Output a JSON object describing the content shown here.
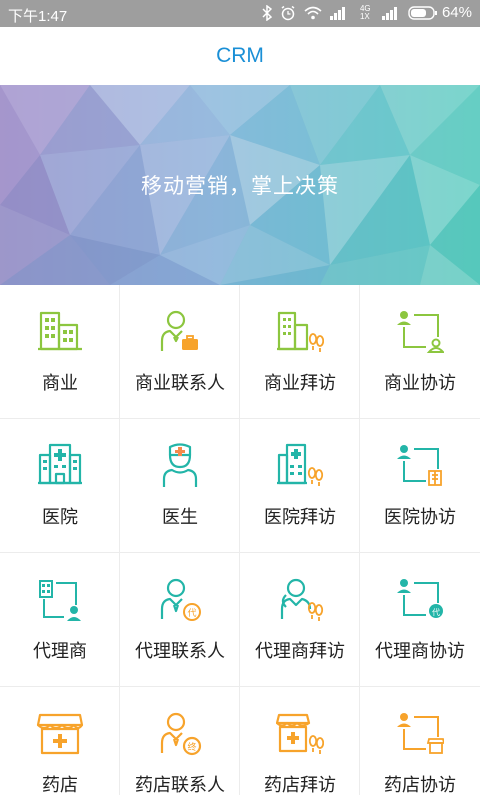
{
  "status": {
    "time": "下午1:47",
    "network": "4G 1X",
    "battery": "64%",
    "icons": [
      "bluetooth-icon",
      "alarm-icon",
      "wifi-icon",
      "signal-icon",
      "battery-icon"
    ]
  },
  "header": {
    "title": "CRM"
  },
  "banner": {
    "slogan": "移动营销，掌上决策"
  },
  "colors": {
    "title": "#1a8fd6",
    "green": "#8cc63f",
    "teal": "#23b5a8",
    "orange": "#f7a32b"
  },
  "menu": {
    "rows": [
      [
        {
          "label": "商业",
          "icon": "buildings-icon"
        },
        {
          "label": "商业联系人",
          "icon": "business-contact-icon"
        },
        {
          "label": "商业拜访",
          "icon": "business-visit-icon"
        },
        {
          "label": "商业协访",
          "icon": "business-assist-visit-icon"
        }
      ],
      [
        {
          "label": "医院",
          "icon": "hospital-icon"
        },
        {
          "label": "医生",
          "icon": "doctor-icon"
        },
        {
          "label": "医院拜访",
          "icon": "hospital-visit-icon"
        },
        {
          "label": "医院协访",
          "icon": "hospital-assist-visit-icon"
        }
      ],
      [
        {
          "label": "代理商",
          "icon": "agent-icon"
        },
        {
          "label": "代理联系人",
          "icon": "agent-contact-icon"
        },
        {
          "label": "代理商拜访",
          "icon": "agent-visit-icon"
        },
        {
          "label": "代理商协访",
          "icon": "agent-assist-visit-icon"
        }
      ],
      [
        {
          "label": "药店",
          "icon": "pharmacy-icon"
        },
        {
          "label": "药店联系人",
          "icon": "pharmacy-contact-icon"
        },
        {
          "label": "药店拜访",
          "icon": "pharmacy-visit-icon"
        },
        {
          "label": "药店协访",
          "icon": "pharmacy-assist-visit-icon"
        }
      ]
    ]
  }
}
